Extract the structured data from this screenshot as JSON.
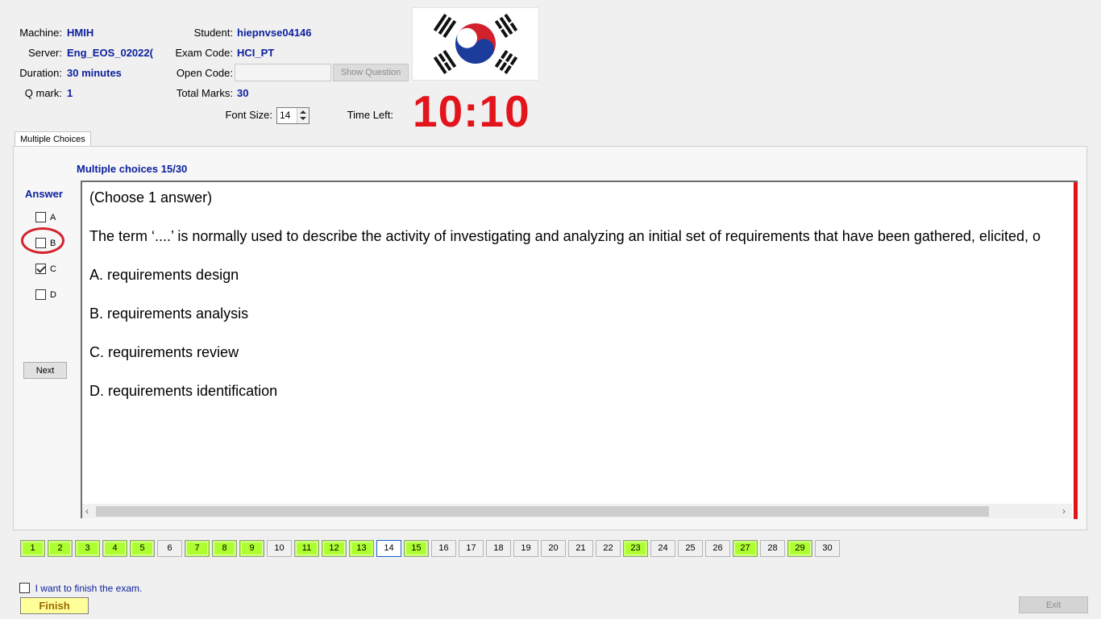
{
  "header": {
    "machine_label": "Machine:",
    "machine_value": "HMIH",
    "server_label": "Server:",
    "server_value": "Eng_EOS_02022(",
    "duration_label": "Duration:",
    "duration_value": "30 minutes",
    "qmark_label": "Q mark:",
    "qmark_value": "1",
    "student_label": "Student:",
    "student_value": "hiepnvse04146",
    "exam_code_label": "Exam Code:",
    "exam_code_value": "HCI_PT",
    "open_code_label": "Open Code:",
    "open_code_value": "",
    "show_question_label": "Show Question",
    "total_marks_label": "Total Marks:",
    "total_marks_value": "30",
    "font_size_label": "Font Size:",
    "font_size_value": "14",
    "time_left_label": "Time Left:",
    "time_left_value": "10:10",
    "flag_icon": "south-korea-flag-icon"
  },
  "tab": {
    "label": "Multiple Choices"
  },
  "question": {
    "progress_label": "Multiple choices 15/30",
    "answer_heading": "Answer",
    "options": [
      {
        "letter": "A",
        "checked": false
      },
      {
        "letter": "B",
        "checked": false
      },
      {
        "letter": "C",
        "checked": true
      },
      {
        "letter": "D",
        "checked": false
      }
    ],
    "next_label": "Next",
    "lines": [
      "(Choose 1 answer)",
      "The term ‘....’ is normally used to describe the activity of investigating and analyzing an initial set of requirements that have been gathered, elicited, o",
      "A.  requirements design",
      "B.  requirements analysis",
      "C.  requirements review",
      "D.  requirements identification"
    ]
  },
  "nav": {
    "numbers": [
      "1",
      "2",
      "3",
      "4",
      "5",
      "6",
      "7",
      "8",
      "9",
      "10",
      "11",
      "12",
      "13",
      "14",
      "15",
      "16",
      "17",
      "18",
      "19",
      "20",
      "21",
      "22",
      "23",
      "24",
      "25",
      "26",
      "27",
      "28",
      "29",
      "30"
    ],
    "answered": [
      1,
      2,
      3,
      4,
      5,
      7,
      8,
      9,
      11,
      12,
      13,
      15,
      23,
      27,
      29
    ],
    "current": 14
  },
  "footer": {
    "finish_checkbox_label": "I want to finish the exam.",
    "finish_label": "Finish",
    "exit_label": "Exit"
  },
  "colors": {
    "answered": "#adff2f",
    "value_text": "#0b1f9c",
    "timer": "#e3141b",
    "annotation_circle": "#d3232d",
    "red_bar": "#e0141b"
  }
}
